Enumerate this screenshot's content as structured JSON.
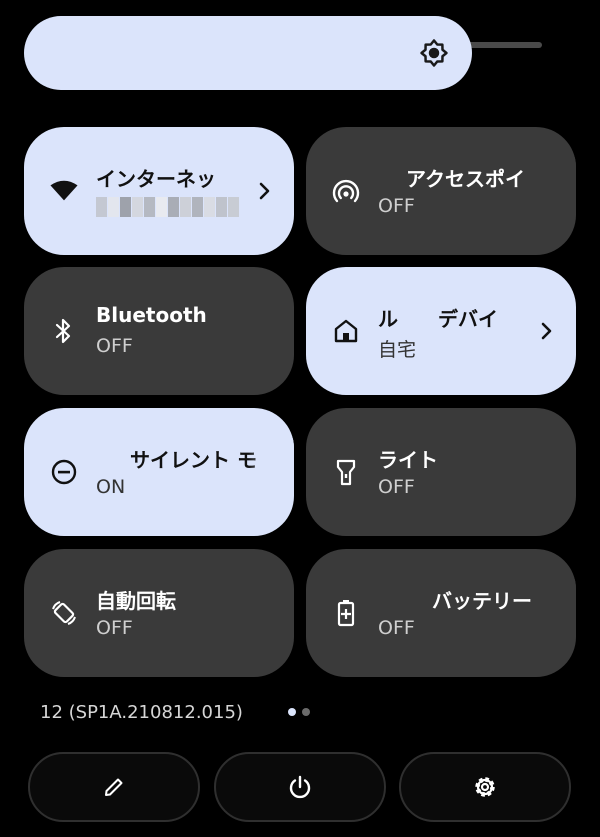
{
  "colors": {
    "tile_on": "#dbe4fb",
    "tile_off": "#3a3a3a",
    "background": "#000000",
    "text_dark": "#111111",
    "text_light": "#ffffff"
  },
  "brightness": {
    "icon": "brightness-icon",
    "level": 0.82
  },
  "tiles": [
    {
      "title": "インターネッ",
      "subtitle_redacted": true,
      "state": "on",
      "icon": "wifi-icon",
      "has_chevron": true
    },
    {
      "title": "アクセスポイ",
      "subtitle": "OFF",
      "state": "off",
      "icon": "hotspot-icon",
      "has_chevron": false
    },
    {
      "title": "Bluetooth",
      "subtitle": "OFF",
      "state": "off",
      "icon": "bluetooth-icon",
      "has_chevron": false
    },
    {
      "title": "ル　　デバイ",
      "subtitle": "自宅",
      "state": "on",
      "icon": "home-icon",
      "has_chevron": true
    },
    {
      "title": "サイレント モ",
      "subtitle": "ON",
      "state": "on",
      "icon": "do-not-disturb-icon",
      "has_chevron": false
    },
    {
      "title": "ライト",
      "subtitle": "OFF",
      "state": "off",
      "icon": "flashlight-icon",
      "has_chevron": false
    },
    {
      "title": "自動回転",
      "subtitle": "OFF",
      "state": "off",
      "icon": "auto-rotate-icon",
      "has_chevron": false
    },
    {
      "title": "バッテリー",
      "subtitle": "OFF",
      "state": "off",
      "icon": "battery-saver-icon",
      "has_chevron": false
    }
  ],
  "footer": {
    "build_number": "12 (SP1A.210812.015)",
    "pages": 2,
    "current_page": 1
  },
  "buttons": [
    {
      "icon": "edit-icon"
    },
    {
      "icon": "power-icon"
    },
    {
      "icon": "settings-icon"
    }
  ]
}
